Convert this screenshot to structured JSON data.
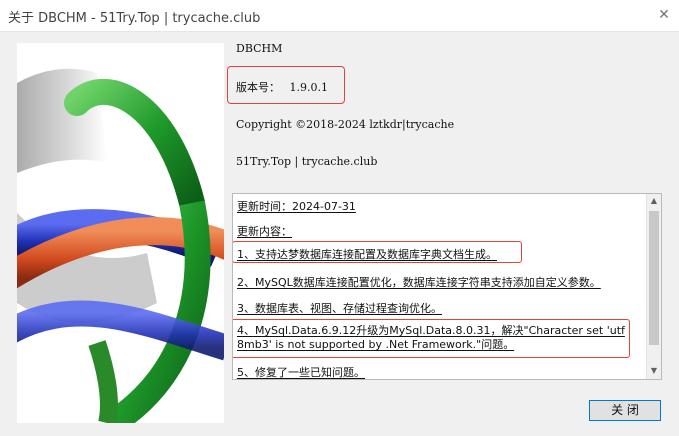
{
  "window": {
    "title": "关于 DBCHM - 51Try.Top | trycache.club",
    "close_glyph": "✕"
  },
  "info": {
    "app_name": "DBCHM",
    "version_label": "版本号：",
    "version_value": "1.9.0.1",
    "copyright": "Copyright ©2018-2024 lztkdr|trycache",
    "sites": "51Try.Top | trycache.club"
  },
  "notes": {
    "update_time": "更新时间：2024-07-31",
    "content_header": "更新内容：",
    "items": [
      "1、支持达梦数据库连接配置及数据库字典文档生成。",
      "2、MySQL数据库连接配置优化，数据库连接字符串支持添加自定义参数。",
      "3、数据库表、视图、存储过程查询优化。",
      "4、MySql.Data.6.9.12升级为MySql.Data.8.0.31，解决\"Character set 'utf8mb3' is not supported by .Net Framework.\"问题。",
      "5、修复了一些已知问题。"
    ]
  },
  "scroll": {
    "up_icon": "▲",
    "down_icon": "▼"
  },
  "buttons": {
    "close_label": "关 闭"
  },
  "colors": {
    "highlight": "#e0443e",
    "ring_green": "#25a32c",
    "ring_red": "#d9532a",
    "ring_blue": "#2b3cc4"
  }
}
